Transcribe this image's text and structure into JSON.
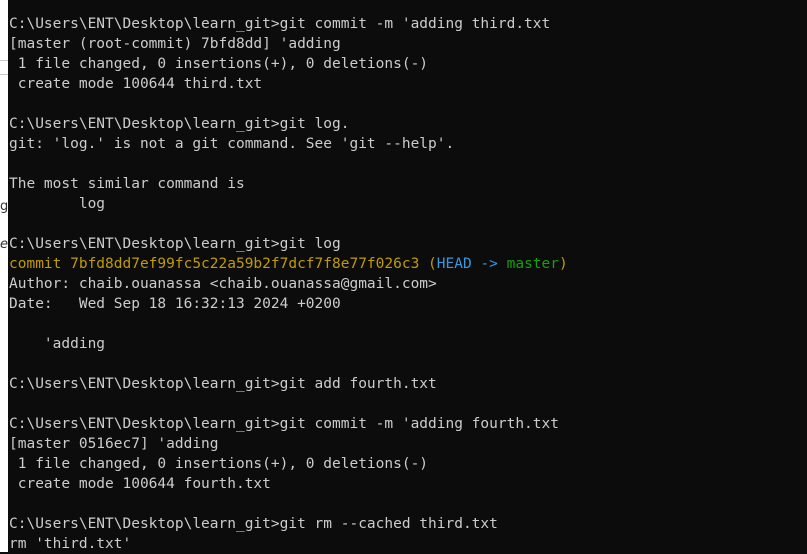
{
  "background_color": "#0c0c0c",
  "foreground_color": "#cccccc",
  "left_strip": {
    "fragments": [
      "g",
      "e"
    ]
  },
  "terminal": {
    "lines": [
      "C:\\Users\\ENT\\Desktop\\learn_git>git commit -m 'adding third.txt",
      "[master (root-commit) 7bfd8dd] 'adding",
      " 1 file changed, 0 insertions(+), 0 deletions(-)",
      " create mode 100644 third.txt",
      "",
      "C:\\Users\\ENT\\Desktop\\learn_git>git log.",
      "git: 'log.' is not a git command. See 'git --help'.",
      "",
      "The most similar command is",
      "        log",
      "",
      "C:\\Users\\ENT\\Desktop\\learn_git>git log",
      "",
      "Author: chaib.ouanassa <chaib.ouanassa@gmail.com>",
      "Date:   Wed Sep 18 16:32:13 2024 +0200",
      "",
      "    'adding",
      "",
      "C:\\Users\\ENT\\Desktop\\learn_git>git add fourth.txt",
      "",
      "C:\\Users\\ENT\\Desktop\\learn_git>git commit -m 'adding fourth.txt",
      "[master 0516ec7] 'adding",
      " 1 file changed, 0 insertions(+), 0 deletions(-)",
      " create mode 100644 fourth.txt",
      "",
      "C:\\Users\\ENT\\Desktop\\learn_git>git rm --cached third.txt",
      "rm 'third.txt'"
    ],
    "commit_line": {
      "prefix": "commit 7bfd8dd7ef99fc5c22a59b2f7dcf7f8e77f026c3 ",
      "open_paren": "(",
      "head": "HEAD -> ",
      "branch": "master",
      "close_paren": ")",
      "colors": {
        "yellow": "#c19c00",
        "cyan": "#3a96dd",
        "green": "#13a10e"
      }
    }
  }
}
